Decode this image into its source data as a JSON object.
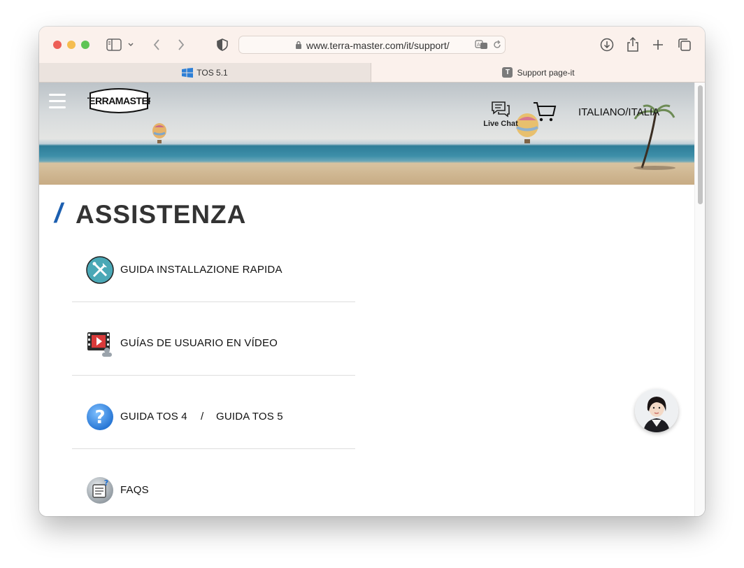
{
  "browser": {
    "url": "www.terra-master.com/it/support/",
    "tabs": [
      {
        "label": "TOS 5.1"
      },
      {
        "label": "Support page-it"
      }
    ]
  },
  "header": {
    "logo_text": "TERRAMASTER",
    "live_chat": "Live Chat",
    "language": "ITALIANO/ITALIA"
  },
  "page": {
    "title": "ASSISTENZA",
    "items": [
      {
        "label": "GUIDA INSTALLAZIONE RAPIDA",
        "icon": "tools-icon"
      },
      {
        "label": "GUÍAS DE USUARIO EN VÍDEO",
        "icon": "video-icon"
      },
      {
        "label": "GUIDA TOS 4",
        "separator": "/",
        "label2": "GUIDA TOS 5",
        "icon": "question-icon"
      },
      {
        "label": "FAQS",
        "icon": "faq-icon"
      }
    ]
  },
  "colors": {
    "accent_blue": "#1c5fb0",
    "title_text": "#333333"
  }
}
